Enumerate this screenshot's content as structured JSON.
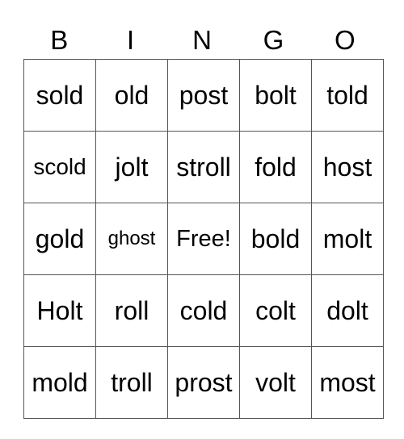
{
  "header": [
    "B",
    "I",
    "N",
    "G",
    "O"
  ],
  "rows": [
    [
      "sold",
      "old",
      "post",
      "bolt",
      "told"
    ],
    [
      "scold",
      "jolt",
      "stroll",
      "fold",
      "host"
    ],
    [
      "gold",
      "ghost",
      "Free!",
      "bold",
      "molt"
    ],
    [
      "Holt",
      "roll",
      "cold",
      "colt",
      "dolt"
    ],
    [
      "mold",
      "troll",
      "prost",
      "volt",
      "most"
    ]
  ]
}
